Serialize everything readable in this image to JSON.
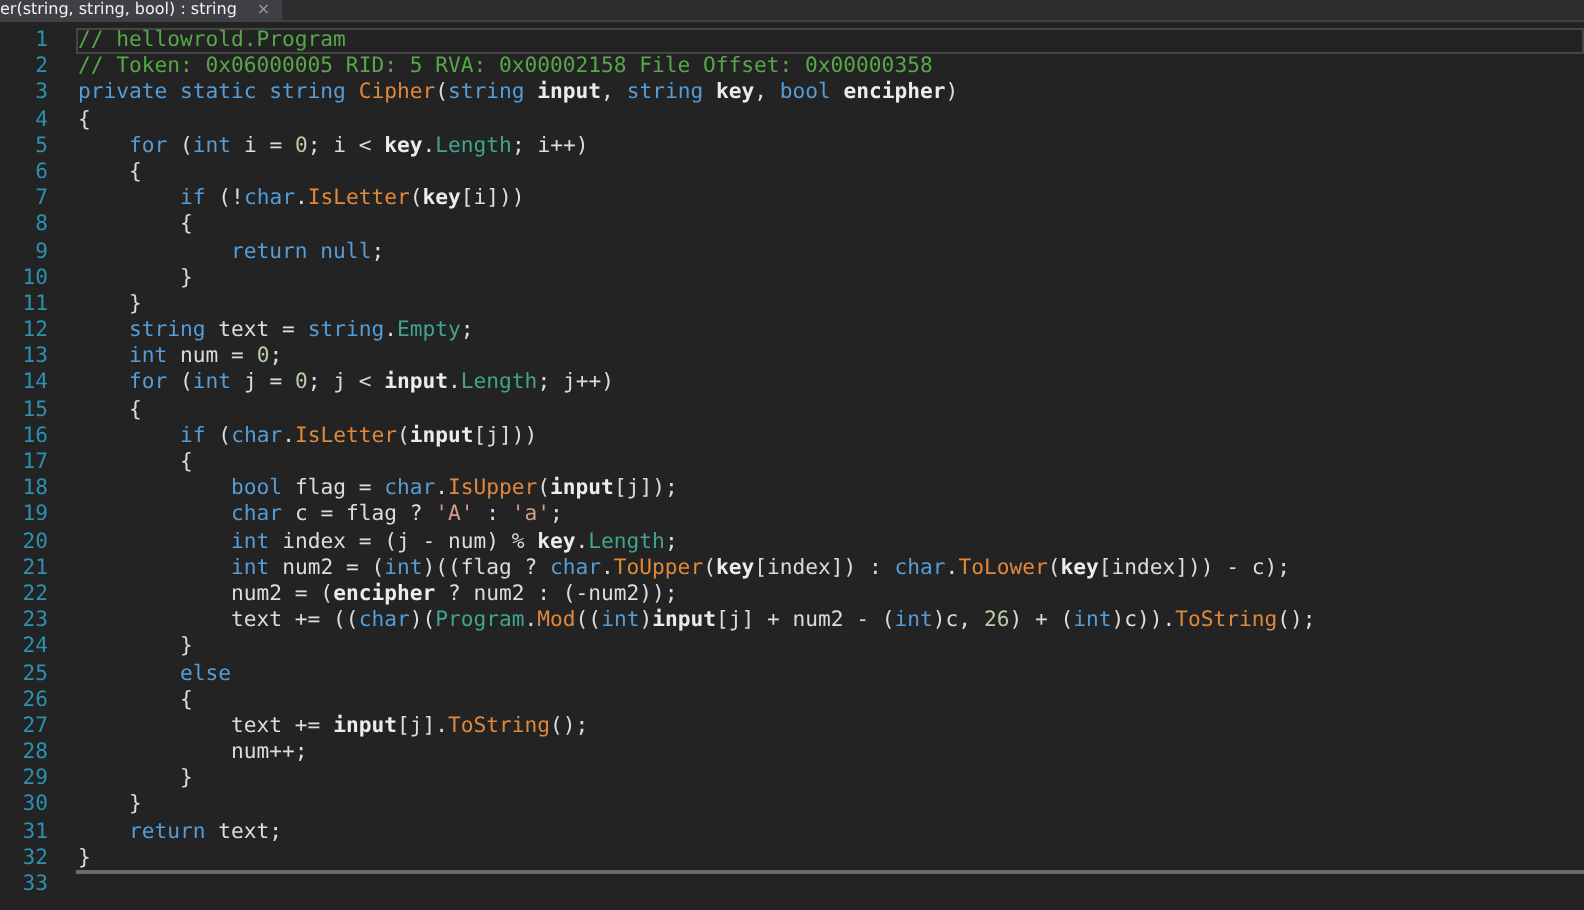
{
  "tab": {
    "label": "er(string, string, bool) : string",
    "close": "×"
  },
  "lines": [
    {
      "number": "1",
      "current": true,
      "rule_below": false,
      "tokens": [
        {
          "kind": "comment",
          "t": "// hellowrold.Program"
        }
      ]
    },
    {
      "number": "2",
      "current": false,
      "rule_below": false,
      "tokens": [
        {
          "kind": "comment",
          "t": "// Token: 0x06000005 RID: 5 RVA: 0x00002158 File Offset: 0x00000358"
        }
      ]
    },
    {
      "number": "3",
      "current": false,
      "rule_below": false,
      "tokens": [
        {
          "kind": "kw",
          "t": "private static string "
        },
        {
          "kind": "method",
          "t": "Cipher"
        },
        {
          "kind": "p",
          "t": "("
        },
        {
          "kind": "kw",
          "t": "string "
        },
        {
          "kind": "param",
          "t": "input"
        },
        {
          "kind": "p",
          "t": ", "
        },
        {
          "kind": "kw",
          "t": "string "
        },
        {
          "kind": "param",
          "t": "key"
        },
        {
          "kind": "p",
          "t": ", "
        },
        {
          "kind": "kw",
          "t": "bool "
        },
        {
          "kind": "param",
          "t": "encipher"
        },
        {
          "kind": "p",
          "t": ")"
        }
      ]
    },
    {
      "number": "4",
      "current": false,
      "rule_below": false,
      "tokens": [
        {
          "kind": "p",
          "t": "{"
        }
      ]
    },
    {
      "number": "5",
      "current": false,
      "rule_below": false,
      "tokens": [
        {
          "kind": "kw",
          "t": "    for "
        },
        {
          "kind": "p",
          "t": "("
        },
        {
          "kind": "kw",
          "t": "int "
        },
        {
          "kind": "p",
          "t": "i = "
        },
        {
          "kind": "num",
          "t": "0"
        },
        {
          "kind": "p",
          "t": "; i < "
        },
        {
          "kind": "param",
          "t": "key"
        },
        {
          "kind": "p",
          "t": "."
        },
        {
          "kind": "type",
          "t": "Length"
        },
        {
          "kind": "p",
          "t": "; i++)"
        }
      ]
    },
    {
      "number": "6",
      "current": false,
      "rule_below": false,
      "tokens": [
        {
          "kind": "p",
          "t": "    {"
        }
      ]
    },
    {
      "number": "7",
      "current": false,
      "rule_below": false,
      "tokens": [
        {
          "kind": "kw",
          "t": "        if "
        },
        {
          "kind": "p",
          "t": "(!"
        },
        {
          "kind": "kw",
          "t": "char"
        },
        {
          "kind": "p",
          "t": "."
        },
        {
          "kind": "method",
          "t": "IsLetter"
        },
        {
          "kind": "p",
          "t": "("
        },
        {
          "kind": "param",
          "t": "key"
        },
        {
          "kind": "p",
          "t": "[i]))"
        }
      ]
    },
    {
      "number": "8",
      "current": false,
      "rule_below": false,
      "tokens": [
        {
          "kind": "p",
          "t": "        {"
        }
      ]
    },
    {
      "number": "9",
      "current": false,
      "rule_below": false,
      "tokens": [
        {
          "kind": "kw",
          "t": "            return null"
        },
        {
          "kind": "p",
          "t": ";"
        }
      ]
    },
    {
      "number": "10",
      "current": false,
      "rule_below": false,
      "tokens": [
        {
          "kind": "p",
          "t": "        }"
        }
      ]
    },
    {
      "number": "11",
      "current": false,
      "rule_below": false,
      "tokens": [
        {
          "kind": "p",
          "t": "    }"
        }
      ]
    },
    {
      "number": "12",
      "current": false,
      "rule_below": false,
      "tokens": [
        {
          "kind": "kw",
          "t": "    string "
        },
        {
          "kind": "p",
          "t": "text = "
        },
        {
          "kind": "kw",
          "t": "string"
        },
        {
          "kind": "p",
          "t": "."
        },
        {
          "kind": "type",
          "t": "Empty"
        },
        {
          "kind": "p",
          "t": ";"
        }
      ]
    },
    {
      "number": "13",
      "current": false,
      "rule_below": false,
      "tokens": [
        {
          "kind": "kw",
          "t": "    int "
        },
        {
          "kind": "p",
          "t": "num = "
        },
        {
          "kind": "num",
          "t": "0"
        },
        {
          "kind": "p",
          "t": ";"
        }
      ]
    },
    {
      "number": "14",
      "current": false,
      "rule_below": false,
      "tokens": [
        {
          "kind": "kw",
          "t": "    for "
        },
        {
          "kind": "p",
          "t": "("
        },
        {
          "kind": "kw",
          "t": "int "
        },
        {
          "kind": "p",
          "t": "j = "
        },
        {
          "kind": "num",
          "t": "0"
        },
        {
          "kind": "p",
          "t": "; j < "
        },
        {
          "kind": "param",
          "t": "input"
        },
        {
          "kind": "p",
          "t": "."
        },
        {
          "kind": "type",
          "t": "Length"
        },
        {
          "kind": "p",
          "t": "; j++)"
        }
      ]
    },
    {
      "number": "15",
      "current": false,
      "rule_below": false,
      "tokens": [
        {
          "kind": "p",
          "t": "    {"
        }
      ]
    },
    {
      "number": "16",
      "current": false,
      "rule_below": false,
      "tokens": [
        {
          "kind": "kw",
          "t": "        if "
        },
        {
          "kind": "p",
          "t": "("
        },
        {
          "kind": "kw",
          "t": "char"
        },
        {
          "kind": "p",
          "t": "."
        },
        {
          "kind": "method",
          "t": "IsLetter"
        },
        {
          "kind": "p",
          "t": "("
        },
        {
          "kind": "param",
          "t": "input"
        },
        {
          "kind": "p",
          "t": "[j]))"
        }
      ]
    },
    {
      "number": "17",
      "current": false,
      "rule_below": false,
      "tokens": [
        {
          "kind": "p",
          "t": "        {"
        }
      ]
    },
    {
      "number": "18",
      "current": false,
      "rule_below": false,
      "tokens": [
        {
          "kind": "kw",
          "t": "            bool "
        },
        {
          "kind": "p",
          "t": "flag = "
        },
        {
          "kind": "kw",
          "t": "char"
        },
        {
          "kind": "p",
          "t": "."
        },
        {
          "kind": "method",
          "t": "IsUpper"
        },
        {
          "kind": "p",
          "t": "("
        },
        {
          "kind": "param",
          "t": "input"
        },
        {
          "kind": "p",
          "t": "[j]);"
        }
      ]
    },
    {
      "number": "19",
      "current": false,
      "rule_below": false,
      "tokens": [
        {
          "kind": "kw",
          "t": "            char "
        },
        {
          "kind": "p",
          "t": "c = flag ? "
        },
        {
          "kind": "str",
          "t": "'A'"
        },
        {
          "kind": "p",
          "t": " : "
        },
        {
          "kind": "str",
          "t": "'a'"
        },
        {
          "kind": "p",
          "t": ";"
        }
      ]
    },
    {
      "number": "20",
      "current": false,
      "rule_below": false,
      "tokens": [
        {
          "kind": "kw",
          "t": "            int "
        },
        {
          "kind": "p",
          "t": "index = (j - num) % "
        },
        {
          "kind": "param",
          "t": "key"
        },
        {
          "kind": "p",
          "t": "."
        },
        {
          "kind": "type",
          "t": "Length"
        },
        {
          "kind": "p",
          "t": ";"
        }
      ]
    },
    {
      "number": "21",
      "current": false,
      "rule_below": false,
      "tokens": [
        {
          "kind": "kw",
          "t": "            int "
        },
        {
          "kind": "p",
          "t": "num2 = ("
        },
        {
          "kind": "kw",
          "t": "int"
        },
        {
          "kind": "p",
          "t": ")((flag ? "
        },
        {
          "kind": "kw",
          "t": "char"
        },
        {
          "kind": "p",
          "t": "."
        },
        {
          "kind": "method",
          "t": "ToUpper"
        },
        {
          "kind": "p",
          "t": "("
        },
        {
          "kind": "param",
          "t": "key"
        },
        {
          "kind": "p",
          "t": "[index]) : "
        },
        {
          "kind": "kw",
          "t": "char"
        },
        {
          "kind": "p",
          "t": "."
        },
        {
          "kind": "method",
          "t": "ToLower"
        },
        {
          "kind": "p",
          "t": "("
        },
        {
          "kind": "param",
          "t": "key"
        },
        {
          "kind": "p",
          "t": "[index])) - c);"
        }
      ]
    },
    {
      "number": "22",
      "current": false,
      "rule_below": false,
      "tokens": [
        {
          "kind": "p",
          "t": "            num2 = ("
        },
        {
          "kind": "param",
          "t": "encipher"
        },
        {
          "kind": "p",
          "t": " ? num2 : (-num2));"
        }
      ]
    },
    {
      "number": "23",
      "current": false,
      "rule_below": false,
      "tokens": [
        {
          "kind": "p",
          "t": "            text += (("
        },
        {
          "kind": "kw",
          "t": "char"
        },
        {
          "kind": "p",
          "t": ")("
        },
        {
          "kind": "type",
          "t": "Program"
        },
        {
          "kind": "p",
          "t": "."
        },
        {
          "kind": "method",
          "t": "Mod"
        },
        {
          "kind": "p",
          "t": "(("
        },
        {
          "kind": "kw",
          "t": "int"
        },
        {
          "kind": "p",
          "t": ")"
        },
        {
          "kind": "param",
          "t": "input"
        },
        {
          "kind": "p",
          "t": "[j] + num2 - ("
        },
        {
          "kind": "kw",
          "t": "int"
        },
        {
          "kind": "p",
          "t": ")c, "
        },
        {
          "kind": "num",
          "t": "26"
        },
        {
          "kind": "p",
          "t": ") + ("
        },
        {
          "kind": "kw",
          "t": "int"
        },
        {
          "kind": "p",
          "t": ")c))."
        },
        {
          "kind": "method",
          "t": "ToString"
        },
        {
          "kind": "p",
          "t": "();"
        }
      ]
    },
    {
      "number": "24",
      "current": false,
      "rule_below": false,
      "tokens": [
        {
          "kind": "p",
          "t": "        }"
        }
      ]
    },
    {
      "number": "25",
      "current": false,
      "rule_below": false,
      "tokens": [
        {
          "kind": "kw",
          "t": "        else"
        }
      ]
    },
    {
      "number": "26",
      "current": false,
      "rule_below": false,
      "tokens": [
        {
          "kind": "p",
          "t": "        {"
        }
      ]
    },
    {
      "number": "27",
      "current": false,
      "rule_below": false,
      "tokens": [
        {
          "kind": "p",
          "t": "            text += "
        },
        {
          "kind": "param",
          "t": "input"
        },
        {
          "kind": "p",
          "t": "[j]."
        },
        {
          "kind": "method",
          "t": "ToString"
        },
        {
          "kind": "p",
          "t": "();"
        }
      ]
    },
    {
      "number": "28",
      "current": false,
      "rule_below": false,
      "tokens": [
        {
          "kind": "p",
          "t": "            num++;"
        }
      ]
    },
    {
      "number": "29",
      "current": false,
      "rule_below": false,
      "tokens": [
        {
          "kind": "p",
          "t": "        }"
        }
      ]
    },
    {
      "number": "30",
      "current": false,
      "rule_below": false,
      "tokens": [
        {
          "kind": "p",
          "t": "    }"
        }
      ]
    },
    {
      "number": "31",
      "current": false,
      "rule_below": false,
      "tokens": [
        {
          "kind": "kw",
          "t": "    return "
        },
        {
          "kind": "p",
          "t": "text;"
        }
      ]
    },
    {
      "number": "32",
      "current": false,
      "rule_below": true,
      "tokens": [
        {
          "kind": "p",
          "t": "}"
        }
      ]
    },
    {
      "number": "33",
      "current": false,
      "rule_below": false
    }
  ]
}
